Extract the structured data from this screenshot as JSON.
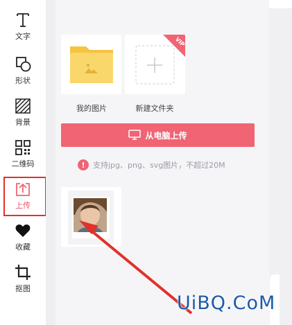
{
  "toolbar": {
    "items": [
      {
        "label": "文字",
        "icon": "text-icon"
      },
      {
        "label": "形状",
        "icon": "shape-icon"
      },
      {
        "label": "背景",
        "icon": "background-icon"
      },
      {
        "label": "二维码",
        "icon": "qrcode-icon"
      },
      {
        "label": "上传",
        "icon": "upload-icon",
        "active": true
      },
      {
        "label": "收藏",
        "icon": "heart-icon"
      },
      {
        "label": "抠图",
        "icon": "crop-icon"
      }
    ]
  },
  "panel": {
    "folders": [
      {
        "label": "我的图片",
        "icon": "folder-image-icon"
      },
      {
        "label": "新建文件夹",
        "icon": "add-icon",
        "badge": "VIP"
      }
    ],
    "upload_button": "从电脑上传",
    "hint": "支持jpg、png、svg图片，不超过20M",
    "hint_icon": "!"
  },
  "colors": {
    "accent": "#f06474",
    "highlight_box": "#e2302a",
    "folder": "#fad76b"
  },
  "watermark": "UiBQ.CoM"
}
